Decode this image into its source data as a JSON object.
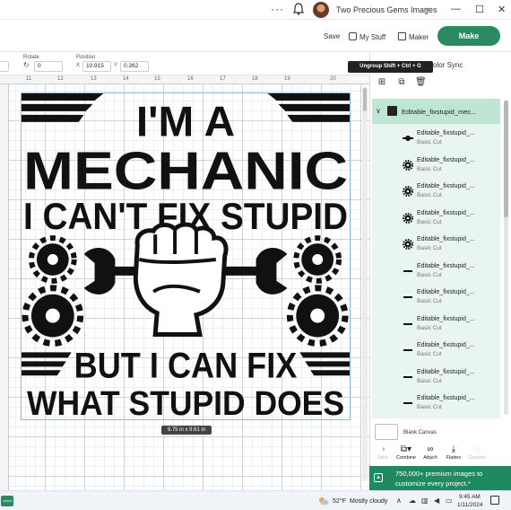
{
  "titlebar": {
    "more_icon": "more-vert-icon",
    "account_name": "Two Precious Gems Images",
    "minimize": "—",
    "restore": "☐",
    "close": "✕"
  },
  "toolbar": {
    "save_label": "Save",
    "mystuff_label": "My Stuff",
    "maker_label": "Maker",
    "make_label": "Make",
    "brand_color": "#2b8a60"
  },
  "editbar": {
    "rotate_label": "Rotate",
    "rotate_value": "0",
    "position_label": "Position",
    "x_label": "X",
    "x_value": "10.915",
    "y_label": "Y",
    "y_value": "0.262"
  },
  "ruler": {
    "numbers": [
      "11",
      "12",
      "13",
      "14",
      "15",
      "16",
      "17",
      "18",
      "19",
      "20"
    ]
  },
  "tooltip": "Ungroup Shift + Ctrl + G",
  "color_sync": "olor Sync",
  "artwork": {
    "line1": "I'M A",
    "line2": "MECHANIC",
    "line3": "I CAN'T FIX STUPID",
    "line4": "BUT I CAN FIX",
    "line5": "WHAT STUPID DOES"
  },
  "size_badge": "9.75  in x 9.61  in",
  "layers": {
    "group_name": "Editable_fixstupid_mec...",
    "items": [
      {
        "name": "Editable_fixstupid_...",
        "sub": "Basic Cut",
        "icon": "wrench-fist-icon"
      },
      {
        "name": "Editable_fixstupid_...",
        "sub": "Basic Cut",
        "icon": "gear-icon"
      },
      {
        "name": "Editable_fixstupid_...",
        "sub": "Basic Cut",
        "icon": "gear-icon"
      },
      {
        "name": "Editable_fixstupid_...",
        "sub": "Basic Cut",
        "icon": "gear-icon"
      },
      {
        "name": "Editable_fixstupid_...",
        "sub": "Basic Cut",
        "icon": "gear-icon"
      },
      {
        "name": "Editable_fixstupid_...",
        "sub": "Basic Cut",
        "icon": "line-icon"
      },
      {
        "name": "Editable_fixstupid_...",
        "sub": "Basic Cut",
        "icon": "line-icon"
      },
      {
        "name": "Editable_fixstupid_...",
        "sub": "Basic Cut",
        "icon": "line-icon"
      },
      {
        "name": "Editable_fixstupid_...",
        "sub": "Basic Cut",
        "icon": "line-icon"
      },
      {
        "name": "Editable_fixstupid_...",
        "sub": "Basic Cut",
        "icon": "line-icon"
      },
      {
        "name": "Editable_fixstupid_...",
        "sub": "Basic Cut",
        "icon": "line-icon"
      }
    ]
  },
  "blank_canvas_label": "Blank Canvas",
  "actions": [
    {
      "label": "Slice",
      "icon": "slice-icon",
      "enabled": false
    },
    {
      "label": "Combine",
      "icon": "combine-icon",
      "enabled": true
    },
    {
      "label": "Attach",
      "icon": "attach-icon",
      "enabled": true
    },
    {
      "label": "Flatten",
      "icon": "flatten-icon",
      "enabled": true
    },
    {
      "label": "Contour",
      "icon": "contour-icon",
      "enabled": false
    }
  ],
  "promo_text": "750,000+ premium images to customize every project.*",
  "taskbar": {
    "temperature": "52°F",
    "weather": "Mostly cloudy",
    "time": "9:45 AM",
    "date": "1/11/2024"
  }
}
